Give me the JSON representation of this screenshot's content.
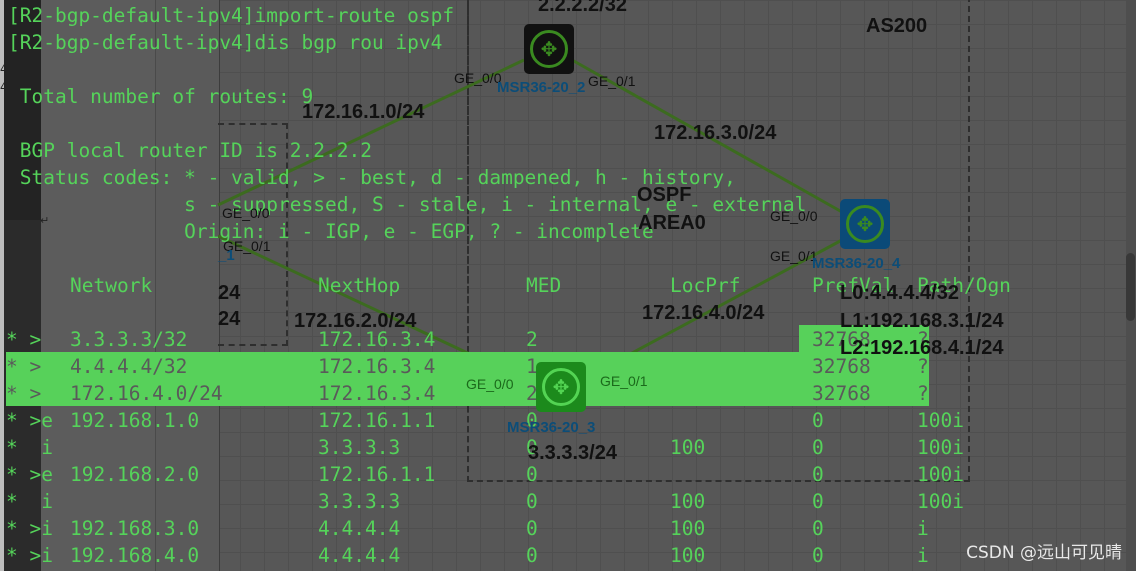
{
  "terminal": {
    "commands": [
      "[R2-bgp-default-ipv4]import-route ospf",
      "[R2-bgp-default-ipv4]dis bgp rou ipv4"
    ],
    "total_routes_line": " Total number of routes: 9",
    "router_id_line": " BGP local router ID is 2.2.2.2",
    "status_codes": [
      " Status codes: * - valid, > - best, d - dampened, h - history,",
      "               s - suppressed, S - stale, i - internal, e - external",
      "               Origin: i - IGP, e - EGP, ? - incomplete"
    ],
    "table": {
      "headers": {
        "network": "Network",
        "nexthop": "NextHop",
        "med": "MED",
        "locprf": "LocPrf",
        "prefval": "PrefVal",
        "path": "Path/Ogn"
      },
      "rows": [
        {
          "status": "* >",
          "network": "3.3.3.3/32",
          "nexthop": "172.16.3.4",
          "med": "2",
          "locprf": "",
          "prefval": "32768",
          "path": "?",
          "highlighted": false
        },
        {
          "status": "* >",
          "network": "4.4.4.4/32",
          "nexthop": "172.16.3.4",
          "med": "1",
          "locprf": "",
          "prefval": "32768",
          "path": "?",
          "highlighted": true
        },
        {
          "status": "* >",
          "network": "172.16.4.0/24",
          "nexthop": "172.16.3.4",
          "med": "2",
          "locprf": "",
          "prefval": "32768",
          "path": "?",
          "highlighted": true
        },
        {
          "status": "* >e",
          "network": "192.168.1.0",
          "nexthop": "172.16.1.1",
          "med": "0",
          "locprf": "",
          "prefval": "0",
          "path": "100i",
          "highlighted": false
        },
        {
          "status": "*  i",
          "network": "",
          "nexthop": "3.3.3.3",
          "med": "0",
          "locprf": "100",
          "prefval": "0",
          "path": "100i",
          "highlighted": false
        },
        {
          "status": "* >e",
          "network": "192.168.2.0",
          "nexthop": "172.16.1.1",
          "med": "0",
          "locprf": "",
          "prefval": "0",
          "path": "100i",
          "highlighted": false
        },
        {
          "status": "*  i",
          "network": "",
          "nexthop": "3.3.3.3",
          "med": "0",
          "locprf": "100",
          "prefval": "0",
          "path": "100i",
          "highlighted": false
        },
        {
          "status": "* >i",
          "network": "192.168.3.0",
          "nexthop": "4.4.4.4",
          "med": "0",
          "locprf": "100",
          "prefval": "0",
          "path": "i",
          "highlighted": false
        },
        {
          "status": "* >i",
          "network": "192.168.4.0",
          "nexthop": "4.4.4.4",
          "med": "0",
          "locprf": "100",
          "prefval": "0",
          "path": "i",
          "highlighted": false
        }
      ]
    }
  },
  "topology": {
    "as_label": "AS200",
    "ospf_label": "OSPF",
    "area_label": "AREA0",
    "routers": [
      {
        "name": "MSR36-20_2",
        "loopback": "2.2.2.2/32",
        "ports": [
          "GE_0/0",
          "GE_0/1"
        ]
      },
      {
        "name": "MSR36-20_3",
        "loopback": "3.3.3.3/24",
        "ports": [
          "GE_0/0",
          "GE_0/1"
        ]
      },
      {
        "name": "MSR36-20_4",
        "loopbacks": [
          "L0:4.4.4.4/32",
          "L1:192.168.3.1/24",
          "L2:192.168.4.1/24"
        ],
        "ports": [
          "GE_0/0",
          "GE_0/1"
        ]
      },
      {
        "name": "_1",
        "ports": [
          "GE_0/0",
          "GE_0/1"
        ],
        "partial_labels": [
          "24",
          "24"
        ]
      }
    ],
    "links": [
      "172.16.1.0/24",
      "172.16.2.0/24",
      "172.16.3.0/24",
      "172.16.4.0/24"
    ]
  },
  "colors": {
    "terminal_text": "#55d35a",
    "highlight": "#57d15a",
    "link": "#3c6b1f",
    "device_label": "#0c4d78"
  },
  "watermark": "CSDN @远山可见晴"
}
